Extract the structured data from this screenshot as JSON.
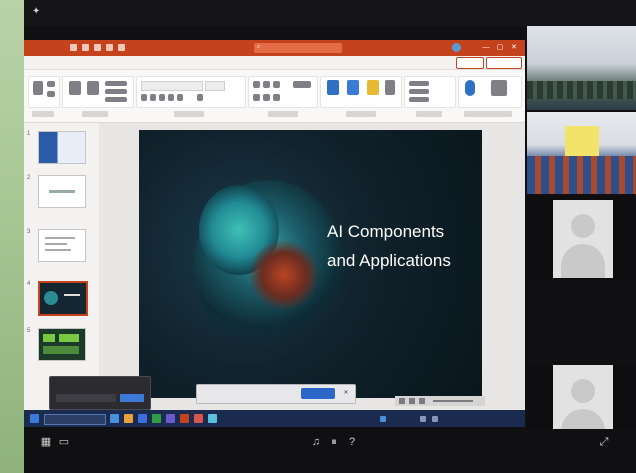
{
  "screen": {
    "titlebar": {
      "autosave_label": "",
      "filename": "",
      "search_placeholder": "",
      "user_name": "",
      "window_buttons": [
        "—",
        "▢",
        "✕"
      ]
    },
    "menu_items": [
      "",
      "",
      "",
      "",
      "",
      "",
      "",
      "",
      "",
      "",
      "",
      "",
      ""
    ],
    "share_label": "",
    "comments_label": "",
    "slide_numbers": [
      "1",
      "2",
      "3",
      "4",
      "5"
    ],
    "slide": {
      "title_line1": "AI Components",
      "title_line2": "and Applications"
    },
    "popup": {
      "text": ""
    },
    "banner": {
      "text": "",
      "button_label": "",
      "close_label": "✕"
    },
    "taskbar": {
      "time": ""
    }
  },
  "controls": {
    "icons": [
      "grid-icon",
      "chat-icon",
      "audio-icon",
      "pause-icon",
      "help-icon",
      "fullscreen-icon"
    ]
  },
  "colors": {
    "ppt_accent": "#c4431c",
    "taskbar": "#1b2a4f",
    "wallpaper": "#a8c895"
  }
}
